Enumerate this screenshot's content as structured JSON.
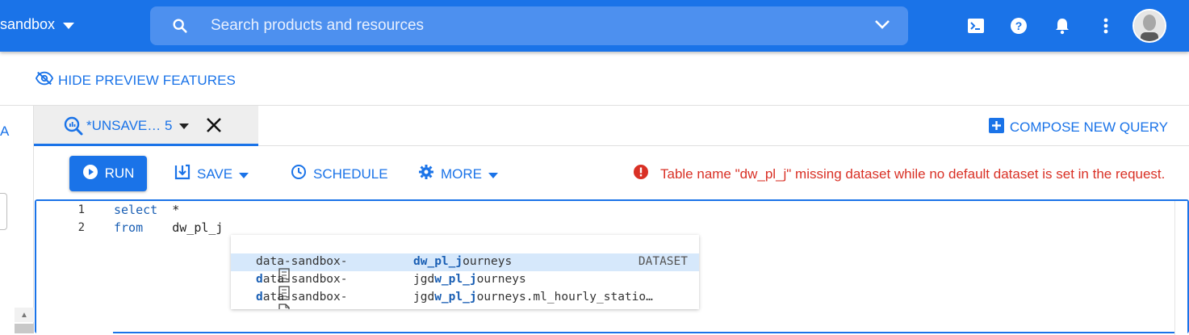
{
  "topbar": {
    "project_name": "sandbox",
    "search_placeholder": "Search products and resources"
  },
  "preview": {
    "label": "HIDE PREVIEW FEATURES"
  },
  "leftpanel": {
    "cut_text": "A"
  },
  "tabs": {
    "active_label": "*UNSAVE… 5",
    "compose_label": "COMPOSE NEW QUERY"
  },
  "toolbar": {
    "run_label": "RUN",
    "save_label": "SAVE",
    "schedule_label": "SCHEDULE",
    "more_label": "MORE",
    "error_text": "Table name \"dw_pl_j\" missing dataset while no default dataset is set in the request."
  },
  "editor": {
    "lines": [
      {
        "number": "1",
        "keyword": "select",
        "text": "*"
      },
      {
        "number": "2",
        "keyword": "from",
        "text": "dw_pl_j"
      }
    ]
  },
  "suggestions": [
    {
      "icon": "dataset-icon",
      "prefix": "data-sandbox-",
      "hl_lead": "",
      "rest_lead": "",
      "sub_pre": "",
      "sub_hl": "dw_pl_j",
      "sub_post": "ourneys",
      "kind": "DATASET",
      "selected": true
    },
    {
      "icon": "dataset-icon",
      "prefix": "ata-sandbox-",
      "hl_lead": "d",
      "rest_lead": "",
      "sub_pre": "jgd",
      "sub_hl": "w_pl_j",
      "sub_post": "ourneys",
      "kind": "",
      "selected": false
    },
    {
      "icon": "table-icon",
      "prefix": "ata-sandbox-",
      "hl_lead": "d",
      "rest_lead": "",
      "sub_pre": "jgd",
      "sub_hl": "w_pl_j",
      "sub_post": "ourneys.ml_hourly_statio…",
      "kind": "",
      "selected": false
    }
  ],
  "colors": {
    "brand": "#1a73e8",
    "error": "#d93025"
  }
}
